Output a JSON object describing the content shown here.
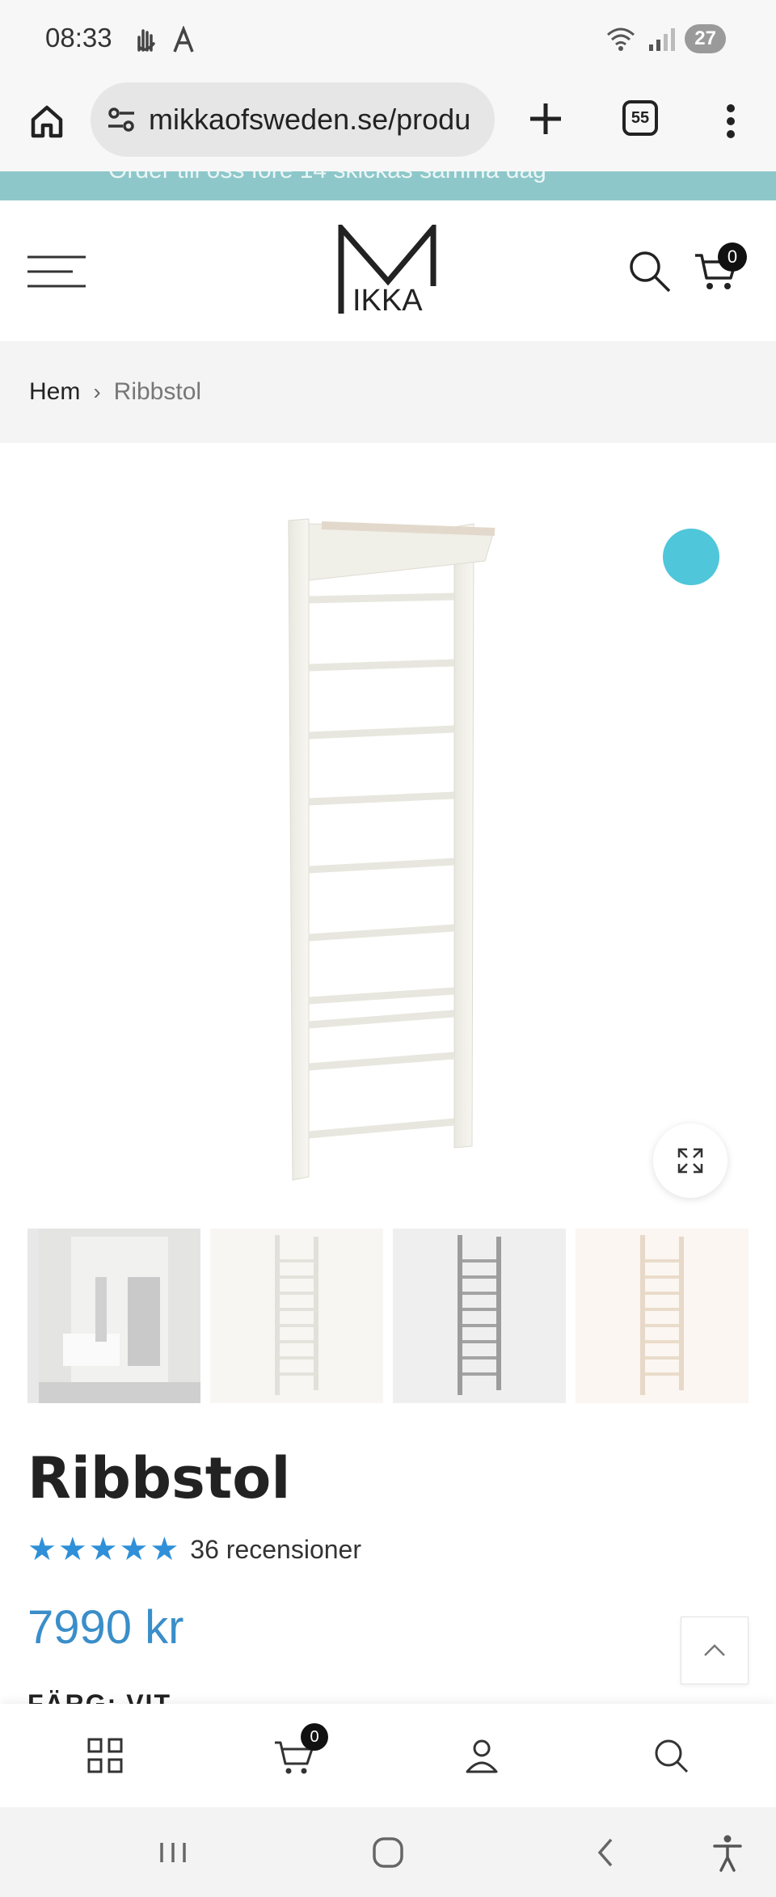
{
  "status_bar": {
    "time": "08:33",
    "battery": "27"
  },
  "browser": {
    "url": "mikkaofsweden.se/produ",
    "tab_count": "55"
  },
  "announcement": {
    "text": "Order till oss före 14 skickas samma dag"
  },
  "header": {
    "logo_text": "IKKA",
    "cart_count": "0"
  },
  "breadcrumb": {
    "home": "Hem",
    "separator": "›",
    "current": "Ribbstol"
  },
  "product": {
    "title": "Ribbstol",
    "rating_stars": "★★★★★",
    "rating_value": 5,
    "review_count": "36 recensioner",
    "price": "7990 kr",
    "color_label": "FÄRG: VIT",
    "swatch_color": "#4fc6da",
    "accent_color": "#3a8ec9"
  },
  "bottom_bar": {
    "cart_count": "0"
  }
}
